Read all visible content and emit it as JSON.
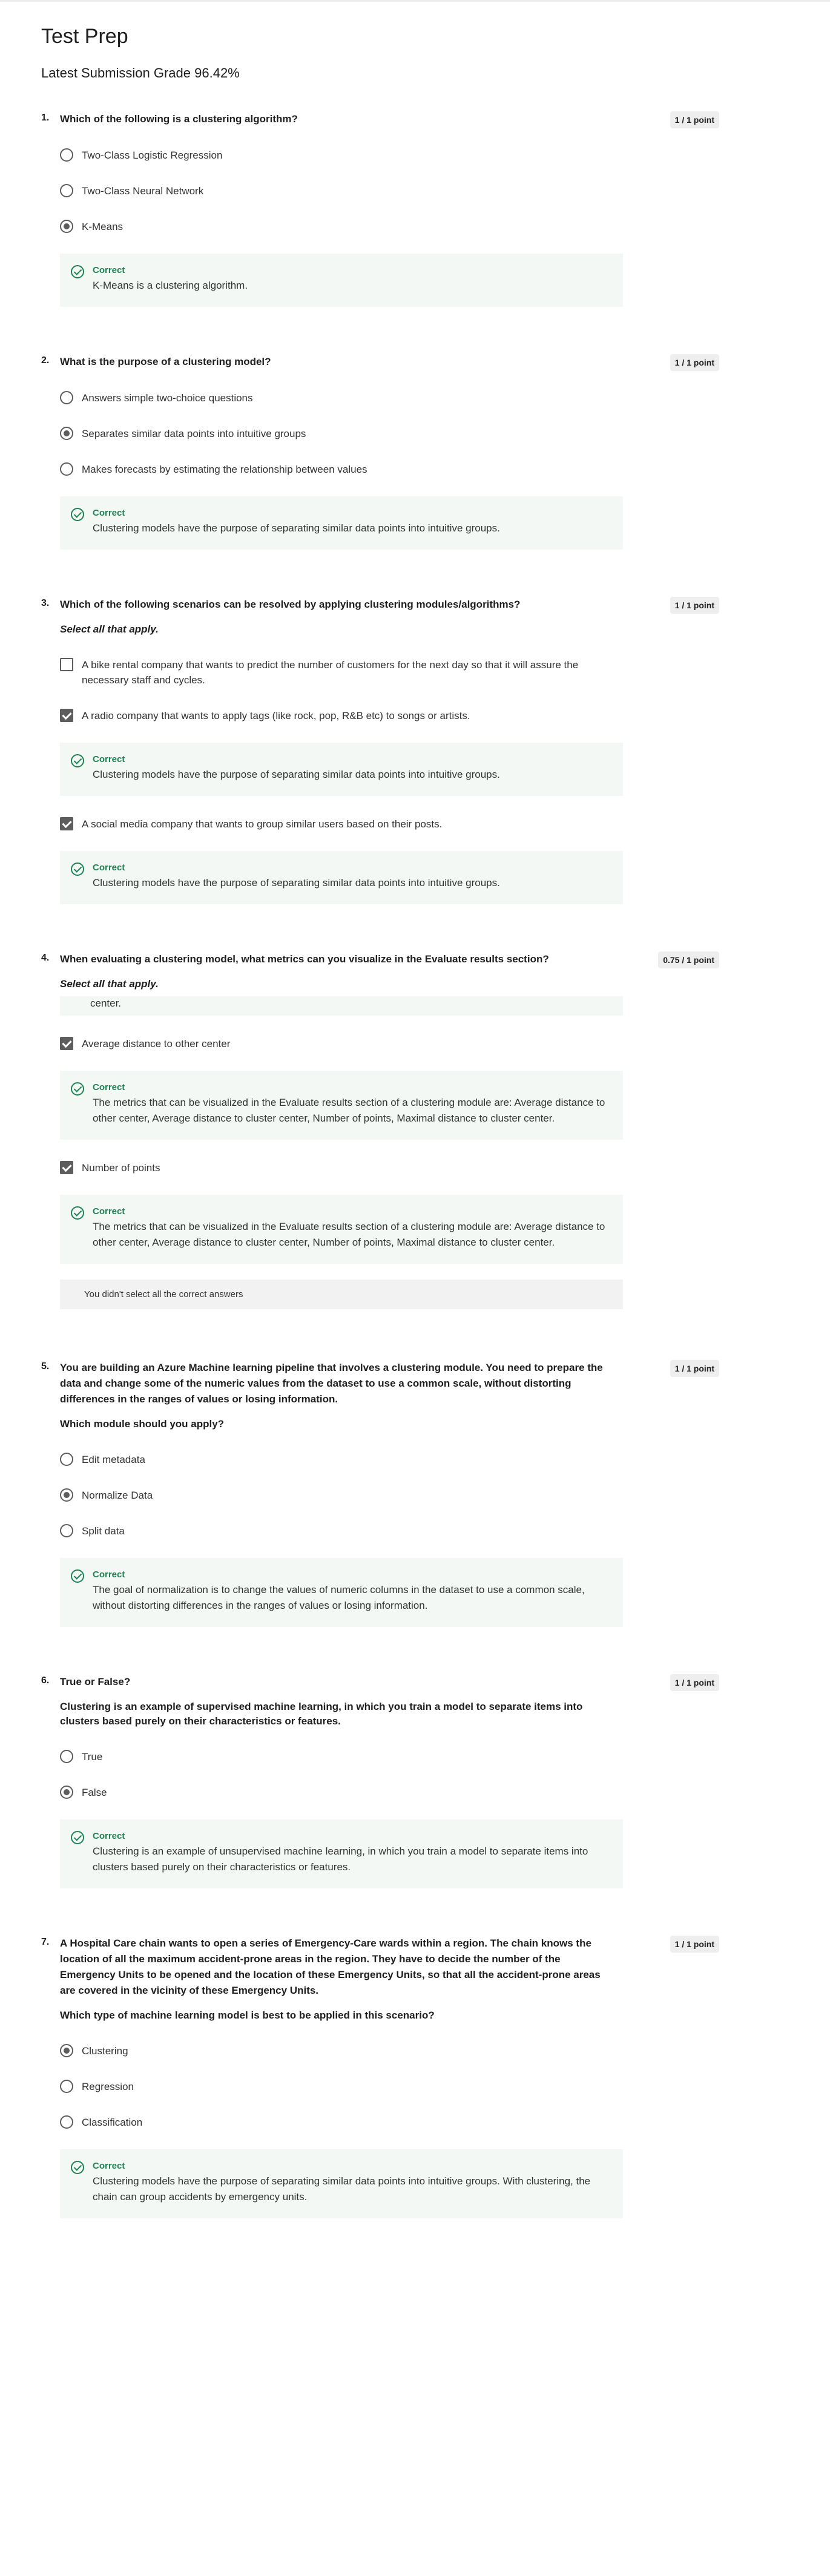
{
  "page": {
    "title": "Test Prep",
    "grade": "Latest Submission Grade 96.42%"
  },
  "questions": [
    {
      "number": "1.",
      "text": "Which of the following is a clustering algorithm?",
      "points": "1 / 1 point",
      "options": [
        "Two-Class Logistic Regression",
        "Two-Class Neural Network",
        "K-Means"
      ],
      "feedback": {
        "title": "Correct",
        "text": "K-Means is a clustering algorithm."
      }
    },
    {
      "number": "2.",
      "text": "What is the purpose of a clustering model?",
      "points": "1 / 1 point",
      "options": [
        "Answers simple two-choice questions",
        "Separates similar data points into intuitive groups",
        "Makes forecasts by estimating the relationship between values"
      ],
      "feedback": {
        "title": "Correct",
        "text": "Clustering models have the purpose of separating similar data points into intuitive groups."
      }
    },
    {
      "number": "3.",
      "text": "Which of the following scenarios can be resolved by applying clustering modules/algorithms?",
      "sub": "Select all that apply.",
      "points": "1 / 1 point",
      "options": [
        "A bike rental company that wants to predict the number of customers for the next day so that it will assure the necessary staff and cycles.",
        "A radio company that wants to apply tags (like rock, pop, R&B etc) to songs or artists.",
        "A social media company that wants to group similar users based on their posts."
      ],
      "feedback": {
        "title": "Correct",
        "text": "Clustering models have the purpose of separating similar data points into intuitive groups."
      }
    },
    {
      "number": "4.",
      "text": "When evaluating a clustering model, what metrics can you visualize in the Evaluate results section?",
      "sub": "Select all that apply.",
      "points": "0.75 / 1 point",
      "partial_text": "center.",
      "options": [
        "Average distance to other center",
        "Number of points"
      ],
      "feedback": {
        "title": "Correct",
        "text": "The metrics that can be visualized in the Evaluate results section of a clustering module are: Average distance to other center, Average distance to cluster center, Number of points, Maximal distance to cluster center."
      },
      "notice": "You didn't select all the correct answers"
    },
    {
      "number": "5.",
      "text": "You are building an Azure Machine learning pipeline that involves a clustering module. You need to prepare the data and change some of the numeric values from the dataset to use a common scale, without distorting differences in the ranges of values or losing information.",
      "sub": "Which module should you apply?",
      "points": "1 / 1 point",
      "options": [
        "Edit metadata",
        "Normalize Data",
        "Split data"
      ],
      "feedback": {
        "title": "Correct",
        "text": "The goal of normalization is to change the values of numeric columns in the dataset to use a common scale, without distorting differences in the ranges of values or losing information."
      }
    },
    {
      "number": "6.",
      "text": "True or False?",
      "sub": "Clustering is an example of supervised machine learning, in which you train a model to separate items into clusters based purely on their characteristics or features.",
      "points": "1 / 1 point",
      "options": [
        "True",
        "False"
      ],
      "feedback": {
        "title": "Correct",
        "text": "Clustering is an example of unsupervised machine learning, in which you train a model to separate items into clusters based purely on their characteristics or features."
      }
    },
    {
      "number": "7.",
      "text": "A Hospital Care chain wants to open a series of Emergency-Care wards within a region. The chain knows the location of all the maximum accident-prone areas in the region. They have to decide the number of the Emergency Units to be opened and the location of these Emergency Units, so that all the accident-prone areas are covered in the vicinity of these Emergency Units.",
      "sub": "Which type of machine learning model is best to be applied in this scenario?",
      "points": "1 / 1 point",
      "options": [
        "Clustering",
        "Regression",
        "Classification"
      ],
      "feedback": {
        "title": "Correct",
        "text": "Clustering models have the purpose of separating similar data points into intuitive groups. With clustering, the chain can group accidents by emergency units."
      }
    }
  ]
}
